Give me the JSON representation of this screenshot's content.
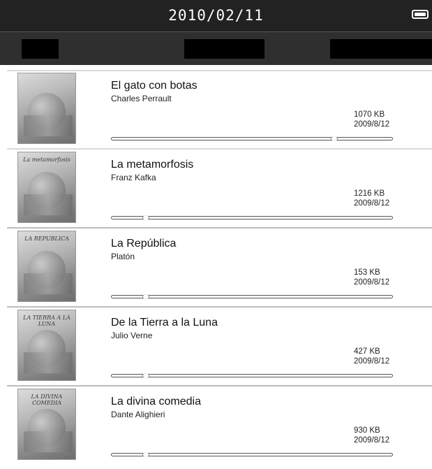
{
  "status_bar": {
    "date": "2010/02/11",
    "battery_icon": "battery-full-icon"
  },
  "toolbar": {
    "buttons": [
      "",
      "",
      ""
    ]
  },
  "books": [
    {
      "title": "El gato con botas",
      "author": "Charles Perrault",
      "size": "1070 KB",
      "date": "2009/8/12",
      "progress": 0.79,
      "cover_text": ""
    },
    {
      "title": "La metamorfosis",
      "author": "Franz Kafka",
      "size": "1216 KB",
      "date": "2009/8/12",
      "progress": 0.12,
      "cover_text": "La metamorfosis"
    },
    {
      "title": "La República",
      "author": "Platón",
      "size": "153 KB",
      "date": "2009/8/12",
      "progress": 0.12,
      "cover_text": "LA REPUBLICA"
    },
    {
      "title": "De la Tierra a la Luna",
      "author": "Julio Verne",
      "size": "427 KB",
      "date": "2009/8/12",
      "progress": 0.12,
      "cover_text": "LA TIERRA A LA LUNA"
    },
    {
      "title": "La divina comedia",
      "author": "Dante Alighieri",
      "size": "930 KB",
      "date": "2009/8/12",
      "progress": 0.12,
      "cover_text": "LA DIVINA COMEDIA"
    }
  ]
}
